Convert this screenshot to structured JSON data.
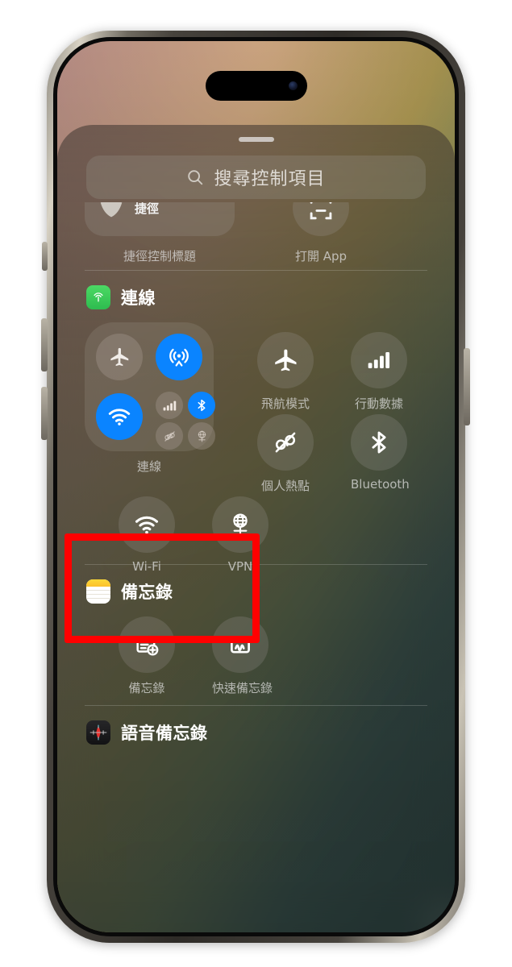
{
  "device": {
    "name": "iPhone 15 Pro",
    "frame_color": "#2e2b27",
    "island_label": "dynamic-island"
  },
  "wallpaper": {
    "top_left_color": "#c89a92",
    "top_right_color": "#b6a057",
    "bottom_color": "#2f4a4a"
  },
  "control_center": {
    "grabber_label": "drag-handle",
    "search": {
      "placeholder": "搜尋控制項目",
      "value": "",
      "icon": "search-icon"
    },
    "partial_row": {
      "shortcut_tile": {
        "inline_label": "捷徑",
        "caption": "捷徑控制標題",
        "icon": "shortcuts-icon"
      },
      "open_app_tile": {
        "caption": "打開 App",
        "icon": "app-frame-icon"
      }
    },
    "groups": [
      {
        "id": "connectivity",
        "title": "連線",
        "icon": "connectivity-icon",
        "icon_color": "#34c759",
        "module": {
          "caption": "連線",
          "buttons": [
            {
              "name": "airplane-mode-button",
              "icon": "airplane-icon",
              "state": "off"
            },
            {
              "name": "airdrop-button",
              "icon": "airdrop-icon",
              "state": "on"
            },
            {
              "name": "wifi-button",
              "icon": "wifi-icon",
              "state": "on"
            },
            {
              "name": "cellular-button",
              "icon": "cellular-bars-icon",
              "state": "off"
            },
            {
              "name": "bluetooth-button",
              "icon": "bluetooth-icon",
              "state": "on"
            },
            {
              "name": "hotspot-button",
              "icon": "hotspot-off-icon",
              "state": "off"
            },
            {
              "name": "vpn-button",
              "icon": "vpn-globe-icon",
              "state": "off"
            }
          ]
        },
        "tiles": [
          {
            "name": "airplane-mode-tile",
            "caption": "飛航模式",
            "icon": "airplane-icon"
          },
          {
            "name": "cellular-data-tile",
            "caption": "行動數據",
            "icon": "cellular-bars-icon"
          },
          {
            "name": "personal-hotspot-tile",
            "caption": "個人熱點",
            "icon": "hotspot-off-icon"
          },
          {
            "name": "bluetooth-tile",
            "caption": "Bluetooth",
            "icon": "bluetooth-icon"
          },
          {
            "name": "wifi-tile",
            "caption": "Wi-Fi",
            "icon": "wifi-icon"
          },
          {
            "name": "vpn-tile",
            "caption": "VPN",
            "icon": "vpn-globe-icon"
          }
        ]
      },
      {
        "id": "notes",
        "title": "備忘錄",
        "icon": "notes-app-icon",
        "icon_color": "#ffcc00",
        "tiles": [
          {
            "name": "new-note-tile",
            "caption": "備忘錄",
            "icon": "new-note-icon"
          },
          {
            "name": "quick-note-tile",
            "caption": "快速備忘錄",
            "icon": "quick-note-icon"
          }
        ]
      },
      {
        "id": "voice-memos",
        "title": "語音備忘錄",
        "icon": "voice-memos-app-icon",
        "icon_color": "#cc2b2b",
        "tiles": []
      }
    ]
  },
  "annotation": {
    "type": "rectangle-highlight",
    "color": "#ff0000",
    "targets": "Wi-Fi / VPN"
  }
}
